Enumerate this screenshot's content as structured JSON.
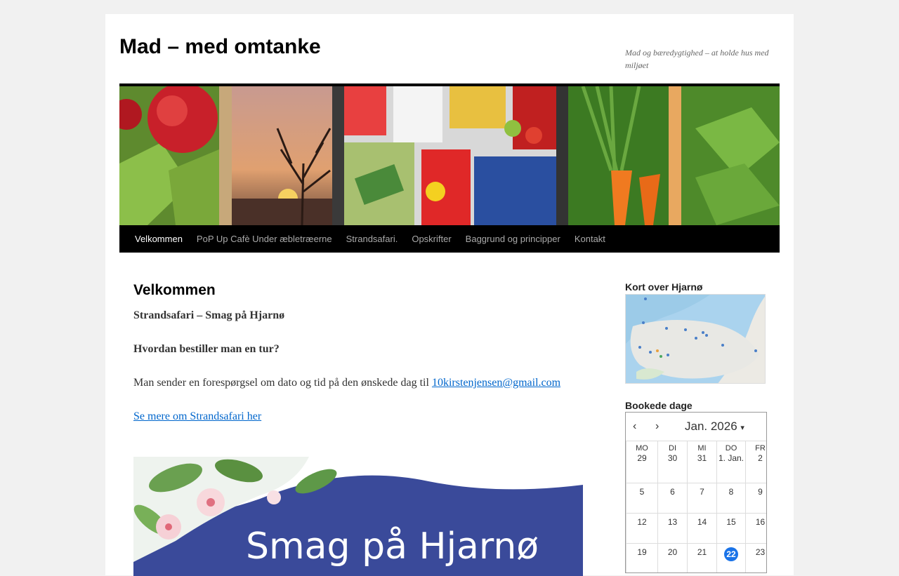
{
  "site": {
    "title": "Mad – med omtanke",
    "description": "Mad og bæredygtighed – at holde hus med miljøet"
  },
  "nav": {
    "items": [
      {
        "label": "Velkommen",
        "current": true
      },
      {
        "label": "PoP Up Cafè Under æbletræerne"
      },
      {
        "label": "Strandsafari."
      },
      {
        "label": "Opskrifter"
      },
      {
        "label": "Baggrund og principper"
      },
      {
        "label": "Kontakt"
      }
    ]
  },
  "content": {
    "heading": "Velkommen",
    "subtitle": "Strandsafari – Smag på Hjarnø",
    "question": "Hvordan bestiller man en tur?",
    "body_text": "Man sender en forespørgsel om dato og tid på den ønskede dag til ",
    "email": "10kirstenjensen@gmail.com",
    "more_link": "Se mere om Strandsafari her",
    "banner_text": "Smag på Hjarnø"
  },
  "sidebar": {
    "map_title": "Kort over Hjarnø",
    "calendar_title": "Bookede dage",
    "calendar": {
      "month_label": "Jan. 2026",
      "prev_icon": "chevron-left-icon",
      "next_icon": "chevron-right-icon",
      "weekdays": [
        "MO",
        "DI",
        "MI",
        "DO",
        "FR"
      ],
      "rows": [
        [
          "29",
          "30",
          "31",
          "1. Jan.",
          "2"
        ],
        [
          "5",
          "6",
          "7",
          "8",
          "9"
        ],
        [
          "12",
          "13",
          "14",
          "15",
          "16"
        ],
        [
          "19",
          "20",
          "21",
          "22",
          "23"
        ]
      ],
      "today": "22"
    }
  },
  "colors": {
    "nav_bg": "#000000",
    "link": "#0066cc",
    "banner_blue": "#3a4a9a",
    "today": "#1a73e8"
  }
}
